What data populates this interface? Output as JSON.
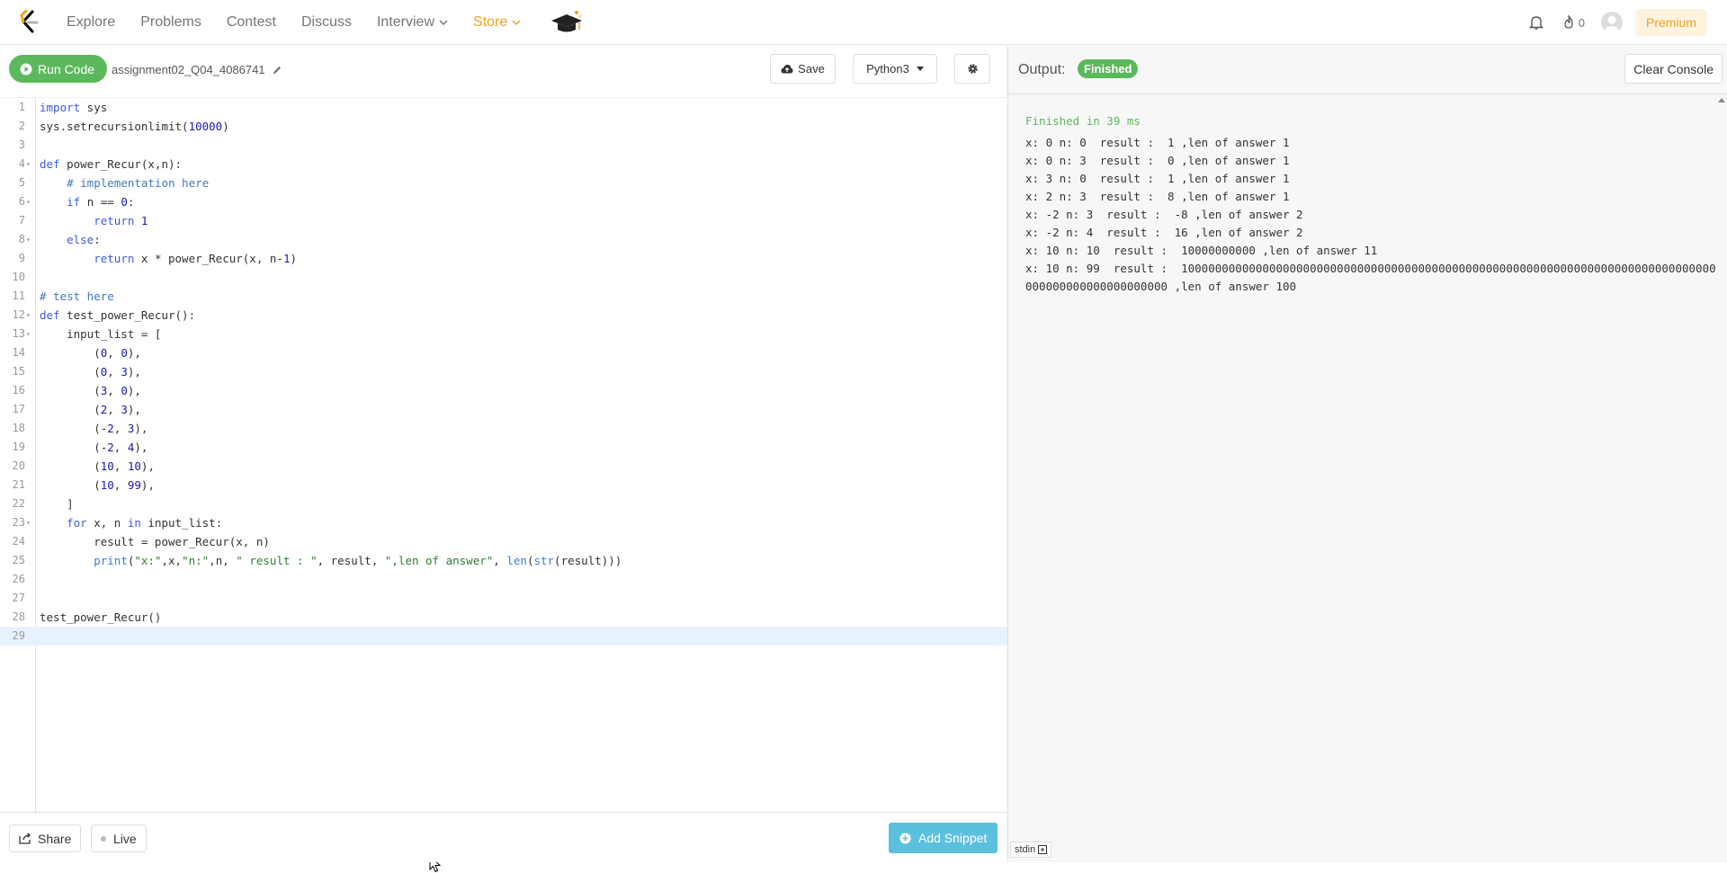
{
  "nav": {
    "links": [
      {
        "label": "Explore"
      },
      {
        "label": "Problems"
      },
      {
        "label": "Contest"
      },
      {
        "label": "Discuss"
      },
      {
        "label": "Interview"
      },
      {
        "label": "Store"
      }
    ],
    "streak_count": "0",
    "premium_label": "Premium"
  },
  "toolbar": {
    "run_label": "Run Code",
    "filename": "assignment02_Q04_4086741",
    "save_label": "Save",
    "language": "Python3"
  },
  "code": {
    "lines": [
      {
        "n": "1",
        "text": "import sys"
      },
      {
        "n": "2",
        "text": "sys.setrecursionlimit(10000)"
      },
      {
        "n": "3",
        "text": ""
      },
      {
        "n": "4",
        "text": "def power_Recur(x,n):"
      },
      {
        "n": "5",
        "text": "    # implementation here"
      },
      {
        "n": "6",
        "text": "    if n == 0:"
      },
      {
        "n": "7",
        "text": "        return 1"
      },
      {
        "n": "8",
        "text": "    else:"
      },
      {
        "n": "9",
        "text": "        return x * power_Recur(x, n-1)"
      },
      {
        "n": "10",
        "text": ""
      },
      {
        "n": "11",
        "text": "# test here"
      },
      {
        "n": "12",
        "text": "def test_power_Recur():"
      },
      {
        "n": "13",
        "text": "    input_list = ["
      },
      {
        "n": "14",
        "text": "        (0, 0),"
      },
      {
        "n": "15",
        "text": "        (0, 3),"
      },
      {
        "n": "16",
        "text": "        (3, 0),"
      },
      {
        "n": "17",
        "text": "        (2, 3),"
      },
      {
        "n": "18",
        "text": "        (-2, 3),"
      },
      {
        "n": "19",
        "text": "        (-2, 4),"
      },
      {
        "n": "20",
        "text": "        (10, 10),"
      },
      {
        "n": "21",
        "text": "        (10, 99),"
      },
      {
        "n": "22",
        "text": "    ]"
      },
      {
        "n": "23",
        "text": "    for x, n in input_list:"
      },
      {
        "n": "24",
        "text": "        result = power_Recur(x, n)"
      },
      {
        "n": "25",
        "text": "        print(\"x:\",x,\"n:\",n, \" result : \", result, \",len of answer\", len(str(result)))"
      },
      {
        "n": "26",
        "text": ""
      },
      {
        "n": "27",
        "text": ""
      },
      {
        "n": "28",
        "text": "test_power_Recur()"
      },
      {
        "n": "29",
        "text": ""
      }
    ],
    "fold_lines": [
      "4",
      "6",
      "8",
      "12",
      "13",
      "23"
    ],
    "active_line": "29"
  },
  "bottom": {
    "share_label": "Share",
    "live_label": "Live",
    "snippet_label": "Add Snippet"
  },
  "output": {
    "label": "Output:",
    "badge": "Finished",
    "clear_label": "Clear Console",
    "status": "Finished in 39 ms",
    "lines": [
      "x: 0 n: 0  result :  1 ,len of answer 1",
      "x: 0 n: 3  result :  0 ,len of answer 1",
      "x: 3 n: 0  result :  1 ,len of answer 1",
      "x: 2 n: 3  result :  8 ,len of answer 1",
      "x: -2 n: 3  result :  -8 ,len of answer 2",
      "x: -2 n: 4  result :  16 ,len of answer 2",
      "x: 10 n: 10  result :  10000000000 ,len of answer 11",
      "x: 10 n: 99  result :  1000000000000000000000000000000000000000000000000000000000000000000000000000000000000000000000000000 ,len of answer 100"
    ],
    "stdin_label": "stdin"
  },
  "colors": {
    "accent_green": "#5cb85c",
    "snippet_blue": "#5bc0de",
    "store_orange": "#f0a020",
    "keyword": "#3b5bdb",
    "comment": "#4078c0",
    "number": "#1a1aa6",
    "string": "#2e7d32"
  }
}
